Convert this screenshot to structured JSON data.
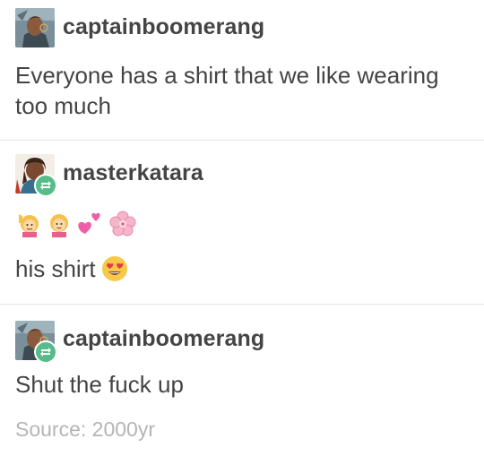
{
  "posts": [
    {
      "username": "captainboomerang",
      "body": "Everyone has a shirt that we like wearing too much",
      "avatar_icon": "character-avatar-icon",
      "reblog": false
    },
    {
      "username": "masterkatara",
      "emoji_icons": [
        "woman-raising-hand-emoji",
        "woman-blonde-emoji",
        "two-hearts-emoji",
        "cherry-blossom-emoji"
      ],
      "body": "his shirt",
      "body_emoji_icon": "heart-eyes-emoji",
      "avatar_icon": "character-avatar-icon",
      "reblog": true
    },
    {
      "username": "captainboomerang",
      "body": "Shut the fuck up",
      "avatar_icon": "character-avatar-icon",
      "reblog": true
    }
  ],
  "source": {
    "label": "Source: 2000yr"
  },
  "colors": {
    "text": "#444444",
    "muted": "#b5b5b5",
    "divider": "#e4e4e4",
    "reblog_green": "#56bc8a"
  }
}
